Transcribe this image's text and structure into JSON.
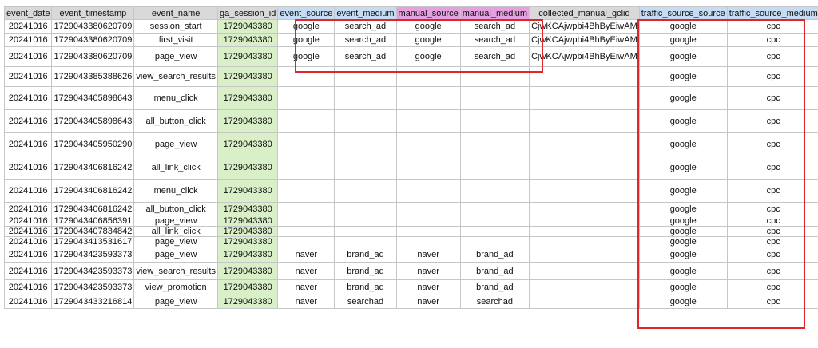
{
  "sheet": {
    "columns": [
      {
        "label": "event_date",
        "color": "#d9d9d9"
      },
      {
        "label": "event_timestamp",
        "color": "#d9d9d9"
      },
      {
        "label": "event_name",
        "color": "#d9d9d9"
      },
      {
        "label": "ga_session_id",
        "color": "#d9d9d9"
      },
      {
        "label": "event_source",
        "color": "#c5dcf3"
      },
      {
        "label": "event_medium",
        "color": "#c5dcf3"
      },
      {
        "label": "manual_source",
        "color": "#e6a0e0"
      },
      {
        "label": "manual_medium",
        "color": "#e6a0e0"
      },
      {
        "label": "collected_manual_gclid",
        "color": "#d9d9d9"
      },
      {
        "label": "traffic_source_source",
        "color": "#c5dcf3"
      },
      {
        "label": "traffic_source_medium",
        "color": "#c5dcf3"
      }
    ],
    "rows": [
      [
        "20241016",
        "1729043380620709",
        "session_start",
        "1729043380",
        "google",
        "search_ad",
        "google",
        "search_ad",
        "CjwKCAjwpbi4BhByEiwAM",
        "google",
        "cpc"
      ],
      [
        "20241016",
        "1729043380620709",
        "first_visit",
        "1729043380",
        "google",
        "search_ad",
        "google",
        "search_ad",
        "CjwKCAjwpbi4BhByEiwAM",
        "google",
        "cpc"
      ],
      [
        "20241016",
        "1729043380620709",
        "page_view",
        "1729043380",
        "google",
        "search_ad",
        "google",
        "search_ad",
        "CjwKCAjwpbi4BhByEiwAM",
        "google",
        "cpc"
      ],
      [
        "20241016",
        "1729043385388626",
        "view_search_results",
        "1729043380",
        "",
        "",
        "",
        "",
        "",
        "google",
        "cpc"
      ],
      [
        "20241016",
        "1729043405898643",
        "menu_click",
        "1729043380",
        "",
        "",
        "",
        "",
        "",
        "google",
        "cpc"
      ],
      [
        "20241016",
        "1729043405898643",
        "all_button_click",
        "1729043380",
        "",
        "",
        "",
        "",
        "",
        "google",
        "cpc"
      ],
      [
        "20241016",
        "1729043405950290",
        "page_view",
        "1729043380",
        "",
        "",
        "",
        "",
        "",
        "google",
        "cpc"
      ],
      [
        "20241016",
        "1729043406816242",
        "all_link_click",
        "1729043380",
        "",
        "",
        "",
        "",
        "",
        "google",
        "cpc"
      ],
      [
        "20241016",
        "1729043406816242",
        "menu_click",
        "1729043380",
        "",
        "",
        "",
        "",
        "",
        "google",
        "cpc"
      ],
      [
        "20241016",
        "1729043406816242",
        "all_button_click",
        "1729043380",
        "",
        "",
        "",
        "",
        "",
        "google",
        "cpc"
      ],
      [
        "20241016",
        "1729043406856391",
        "page_view",
        "1729043380",
        "",
        "",
        "",
        "",
        "",
        "google",
        "cpc"
      ],
      [
        "20241016",
        "1729043407834842",
        "all_link_click",
        "1729043380",
        "",
        "",
        "",
        "",
        "",
        "google",
        "cpc"
      ],
      [
        "20241016",
        "1729043413531617",
        "page_view",
        "1729043380",
        "",
        "",
        "",
        "",
        "",
        "google",
        "cpc"
      ],
      [
        "20241016",
        "1729043423593373",
        "page_view",
        "1729043380",
        "naver",
        "brand_ad",
        "naver",
        "brand_ad",
        "",
        "google",
        "cpc"
      ],
      [
        "20241016",
        "1729043423593373",
        "view_search_results",
        "1729043380",
        "naver",
        "brand_ad",
        "naver",
        "brand_ad",
        "",
        "google",
        "cpc"
      ],
      [
        "20241016",
        "1729043423593373",
        "view_promotion",
        "1729043380",
        "naver",
        "brand_ad",
        "naver",
        "brand_ad",
        "",
        "google",
        "cpc"
      ],
      [
        "20241016",
        "1729043433216814",
        "page_view",
        "1729043380",
        "naver",
        "searchad",
        "naver",
        "searchad",
        "",
        "google",
        "cpc"
      ]
    ]
  },
  "highlight_color": "#e0262b"
}
